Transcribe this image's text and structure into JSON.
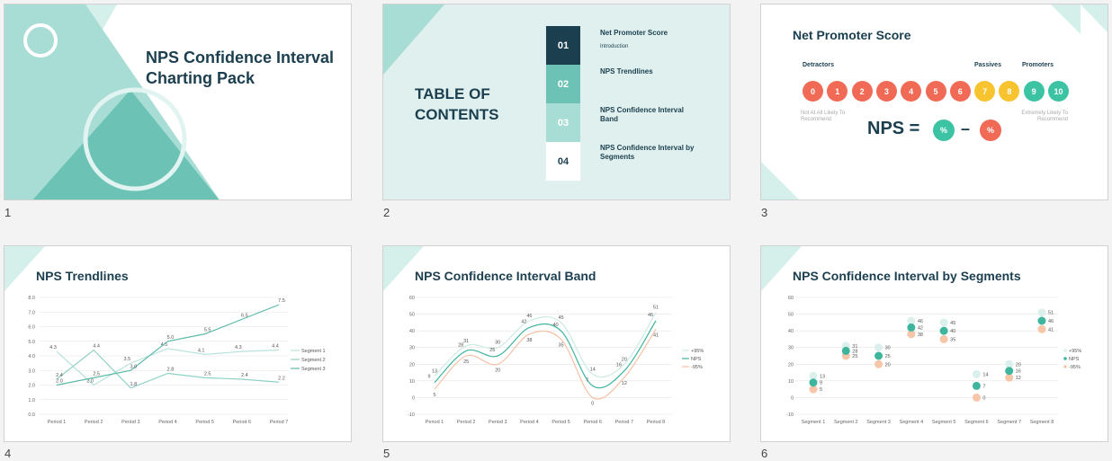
{
  "colors": {
    "teal_light": "#a8ddd5",
    "teal": "#6cc3b5",
    "teal_bg": "#dff0ee",
    "navy": "#1b3f4f",
    "orange": "#f7c5a8",
    "red": "#f06a55",
    "amber": "#f7c32e",
    "green": "#3cc3a4"
  },
  "slides": [
    {
      "num": "1",
      "title": "NPS Confidence Interval Charting Pack"
    },
    {
      "num": "2",
      "title": "TABLE OF CONTENTS",
      "toc": [
        {
          "n": "01",
          "label": "Net Promoter Score",
          "sub": "Introduction"
        },
        {
          "n": "02",
          "label": "NPS Trendlines",
          "sub": ""
        },
        {
          "n": "03",
          "label": "NPS Confidence Interval Band",
          "sub": ""
        },
        {
          "n": "04",
          "label": "NPS Confidence Interval by Segments",
          "sub": ""
        }
      ]
    },
    {
      "num": "3",
      "title": "Net Promoter Score",
      "detractors": "Detractors",
      "passives": "Passives",
      "promoters": "Promoters",
      "scale": [
        "0",
        "1",
        "2",
        "3",
        "4",
        "5",
        "6",
        "7",
        "8",
        "9",
        "10"
      ],
      "low_label": "Not At All Likely To Recommend",
      "high_label": "Extremely Likely To Recommend",
      "formula": "NPS =",
      "pct": "%",
      "minus": "–"
    },
    {
      "num": "4",
      "title": "NPS Trendlines"
    },
    {
      "num": "5",
      "title": "NPS Confidence Interval Band"
    },
    {
      "num": "6",
      "title": "NPS Confidence Interval by Segments"
    }
  ],
  "chart_data": [
    {
      "type": "line",
      "slide": "4",
      "categories": [
        "Period 1",
        "Period 2",
        "Period 3",
        "Period 4",
        "Period 5",
        "Period 6",
        "Period 7"
      ],
      "ylim": [
        0,
        8
      ],
      "yticks": [
        "0.0",
        "1.0",
        "2.0",
        "3.0",
        "4.0",
        "5.0",
        "6.0",
        "7.0",
        "8.0"
      ],
      "series": [
        {
          "name": "Segment 1",
          "values": [
            4.3,
            2.0,
            3.5,
            4.5,
            4.1,
            4.3,
            4.4
          ],
          "labels": [
            "4.3",
            "2.0",
            "3.5",
            "4.5",
            "4.1",
            "4.3",
            "4.4"
          ]
        },
        {
          "name": "Segment 2",
          "values": [
            2.4,
            4.4,
            1.8,
            2.8,
            2.5,
            2.4,
            2.2
          ],
          "labels": [
            "2.4",
            "4.4",
            "1.8",
            "2.8",
            "2.5",
            "2.4",
            "2.2"
          ]
        },
        {
          "name": "Segment 3",
          "values": [
            2.0,
            2.5,
            3.0,
            5.0,
            5.5,
            6.5,
            7.5
          ],
          "labels": [
            "2.0",
            "2.5",
            "3.0",
            "5.0",
            "5.5",
            "6.5",
            "7.5"
          ]
        }
      ]
    },
    {
      "type": "line",
      "slide": "5",
      "categories": [
        "Period 1",
        "Period 2",
        "Period 3",
        "Period 4",
        "Period 5",
        "Period 6",
        "Period 7",
        "Period 8"
      ],
      "ylim": [
        -10,
        60
      ],
      "yticks": [
        "-10",
        "0",
        "10",
        "20",
        "30",
        "40",
        "50",
        "60"
      ],
      "series": [
        {
          "name": "+95%",
          "values": [
            13,
            31,
            30,
            46,
            45,
            14,
            20,
            51
          ]
        },
        {
          "name": "NPS",
          "values": [
            9,
            28,
            25,
            42,
            40,
            7,
            16,
            46
          ]
        },
        {
          "name": "-95%",
          "values": [
            5,
            25,
            20,
            38,
            35,
            0,
            12,
            41
          ]
        }
      ]
    },
    {
      "type": "scatter",
      "slide": "6",
      "categories": [
        "Segment 1",
        "Segment 2",
        "Segment 3",
        "Segment 4",
        "Segment 5",
        "Segment 6",
        "Segment 7",
        "Segment 8"
      ],
      "ylim": [
        -10,
        60
      ],
      "yticks": [
        "-10",
        "0",
        "10",
        "20",
        "30",
        "40",
        "50",
        "60"
      ],
      "series": [
        {
          "name": "+95%",
          "values": [
            13,
            31,
            30,
            46,
            45,
            14,
            20,
            51
          ]
        },
        {
          "name": "NPS",
          "values": [
            9,
            28,
            25,
            42,
            40,
            7,
            16,
            46
          ]
        },
        {
          "name": "-95%",
          "values": [
            5,
            25,
            20,
            38,
            35,
            0,
            12,
            41
          ]
        }
      ]
    }
  ]
}
